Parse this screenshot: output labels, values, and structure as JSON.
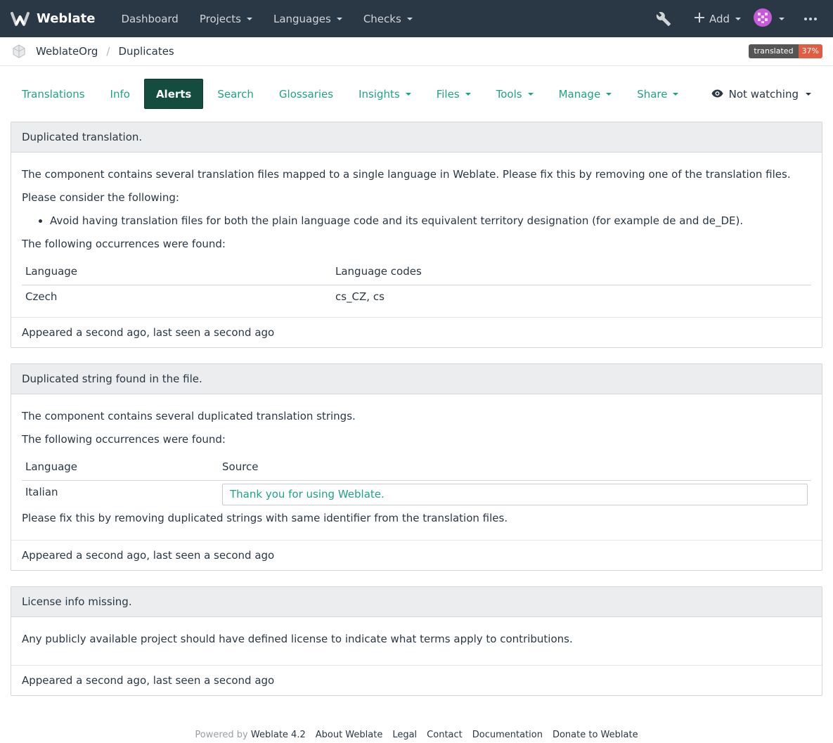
{
  "navbar": {
    "brand": "Weblate",
    "items": [
      {
        "label": "Dashboard",
        "dropdown": false
      },
      {
        "label": "Projects",
        "dropdown": true
      },
      {
        "label": "Languages",
        "dropdown": true
      },
      {
        "label": "Checks",
        "dropdown": true
      }
    ],
    "add_label": "Add",
    "icons": [
      "weblate-logo-icon",
      "wrench-icon",
      "plus-icon",
      "avatar-icon",
      "more-dots-icon"
    ]
  },
  "breadcrumb": {
    "project": "WeblateOrg",
    "component": "Duplicates"
  },
  "badge": {
    "label": "translated",
    "value": "37%",
    "label_color": "#555555",
    "value_color": "#e05d44"
  },
  "tabs": [
    {
      "label": "Translations"
    },
    {
      "label": "Info"
    },
    {
      "label": "Alerts"
    },
    {
      "label": "Search"
    },
    {
      "label": "Glossaries"
    },
    {
      "label": "Insights"
    },
    {
      "label": "Files"
    },
    {
      "label": "Tools"
    },
    {
      "label": "Manage"
    },
    {
      "label": "Share"
    }
  ],
  "watch_label": "Not watching",
  "alerts": [
    {
      "title": "Duplicated translation.",
      "description": "The component contains several translation files mapped to a single language in Weblate. Please fix this by removing one of the translation files.",
      "consider": "Please consider the following:",
      "bullet": "Avoid having translation files for both the plain language code and its equivalent territory designation (for example de and de_DE).",
      "occurrences": "The following occurrences were found:",
      "table": {
        "headers": [
          "Language",
          "Language codes"
        ],
        "rows": [
          [
            "Czech",
            "cs_CZ, cs"
          ]
        ]
      },
      "footer": "Appeared a second ago, last seen a second ago"
    },
    {
      "title": "Duplicated string found in the file.",
      "description": "The component contains several duplicated translation strings.",
      "occurrences": "The following occurrences were found:",
      "table": {
        "headers": [
          "Language",
          "Source"
        ],
        "rows": [
          [
            "Italian",
            "Thank you for using Weblate."
          ]
        ]
      },
      "fix": "Please fix this by removing duplicated strings with same identifier from the translation files.",
      "footer": "Appeared a second ago, last seen a second ago"
    },
    {
      "title": "License info missing.",
      "description": "Any publicly available project should have defined license to indicate what terms apply to contributions.",
      "footer": "Appeared a second ago, last seen a second ago"
    }
  ],
  "footer": {
    "powered": "Powered by",
    "version": "Weblate 4.2",
    "links": [
      "About Weblate",
      "Legal",
      "Contact",
      "Documentation",
      "Donate to Weblate"
    ]
  },
  "colors": {
    "navbar": "#2a3744",
    "accent": "#1fa385",
    "active_tab": "#144d3f"
  }
}
